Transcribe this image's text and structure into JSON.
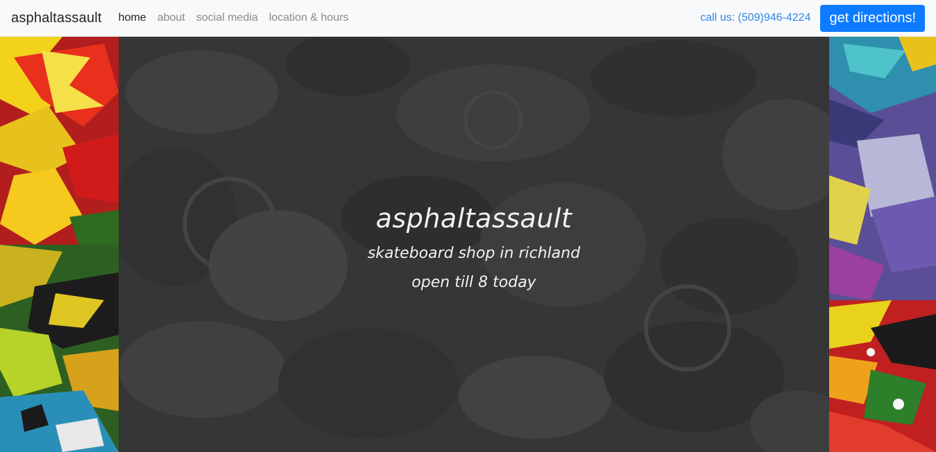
{
  "navbar": {
    "brand": "asphaltassault",
    "links": [
      {
        "label": "home",
        "active": true
      },
      {
        "label": "about",
        "active": false
      },
      {
        "label": "social media",
        "active": false
      },
      {
        "label": "location & hours",
        "active": false
      }
    ],
    "call_label": "call us: (509)946-4224",
    "directions_label": "get directions!"
  },
  "hero": {
    "title": "asphaltassault",
    "subtitle": "skateboard shop in richland",
    "hours": "open till 8 today"
  },
  "colors": {
    "navbar_bg": "#f8f9fa",
    "accent": "#0d7bff",
    "call_link": "#2f86e8",
    "hero_overlay": "#333333"
  }
}
